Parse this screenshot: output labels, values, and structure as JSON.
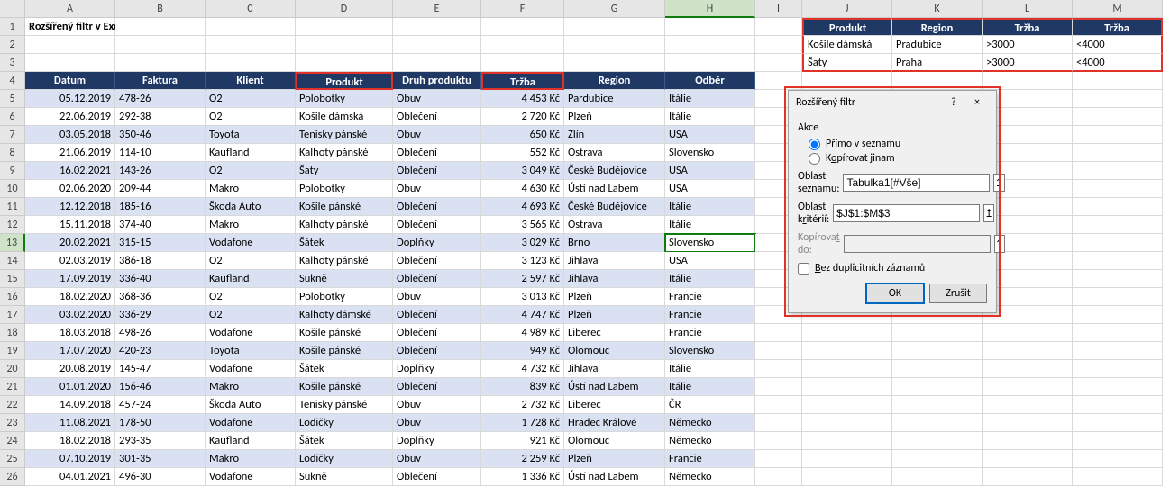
{
  "columns": [
    "A",
    "B",
    "C",
    "D",
    "E",
    "F",
    "G",
    "H",
    "I",
    "J",
    "K",
    "L",
    "M"
  ],
  "row_count": 26,
  "title_cell": "Rozšířený filtr v Excelu",
  "table": {
    "headers": [
      "Datum",
      "Faktura",
      "Klient",
      "Produkt",
      "Druh produktu",
      "Tržba",
      "Region",
      "Odběr"
    ],
    "rows": [
      [
        "05.12.2019",
        "478-26",
        "O2",
        "Polobotky",
        "Obuv",
        "4 453 Kč",
        "Pardubice",
        "Itálie"
      ],
      [
        "22.06.2019",
        "292-38",
        "O2",
        "Košile dámská",
        "Oblečení",
        "2 720 Kč",
        "Plzeň",
        "Itálie"
      ],
      [
        "03.05.2018",
        "350-46",
        "Toyota",
        "Tenisky pánské",
        "Obuv",
        "650 Kč",
        "Zlín",
        "USA"
      ],
      [
        "21.06.2019",
        "114-10",
        "Kaufland",
        "Kalhoty pánské",
        "Oblečení",
        "552 Kč",
        "Ostrava",
        "Slovensko"
      ],
      [
        "16.02.2021",
        "143-26",
        "O2",
        "Šaty",
        "Oblečení",
        "3 049 Kč",
        "České Budějovice",
        "USA"
      ],
      [
        "02.06.2020",
        "209-44",
        "Makro",
        "Polobotky",
        "Obuv",
        "4 630 Kč",
        "Ústí nad Labem",
        "USA"
      ],
      [
        "12.12.2018",
        "185-16",
        "Škoda Auto",
        "Košile pánské",
        "Oblečení",
        "4 693 Kč",
        "České Budějovice",
        "Itálie"
      ],
      [
        "15.11.2018",
        "374-40",
        "Makro",
        "Kalhoty pánské",
        "Oblečení",
        "3 565 Kč",
        "Ostrava",
        "Itálie"
      ],
      [
        "20.02.2021",
        "315-15",
        "Vodafone",
        "Šátek",
        "Doplňky",
        "3 029 Kč",
        "Brno",
        "Slovensko"
      ],
      [
        "02.03.2019",
        "386-18",
        "O2",
        "Kalhoty pánské",
        "Oblečení",
        "3 123 Kč",
        "Jihlava",
        "USA"
      ],
      [
        "17.09.2019",
        "336-40",
        "Kaufland",
        "Sukně",
        "Oblečení",
        "2 597 Kč",
        "Jihlava",
        "Itálie"
      ],
      [
        "18.02.2020",
        "368-36",
        "O2",
        "Polobotky",
        "Obuv",
        "3 013 Kč",
        "Plzeň",
        "Francie"
      ],
      [
        "03.02.2020",
        "336-29",
        "O2",
        "Kalhoty dámské",
        "Oblečení",
        "4 747 Kč",
        "Plzeň",
        "Francie"
      ],
      [
        "18.03.2018",
        "498-26",
        "Vodafone",
        "Košile pánské",
        "Oblečení",
        "4 989 Kč",
        "Liberec",
        "Francie"
      ],
      [
        "17.07.2020",
        "420-23",
        "Toyota",
        "Košile pánské",
        "Oblečení",
        "949 Kč",
        "Olomouc",
        "Slovensko"
      ],
      [
        "20.08.2019",
        "145-47",
        "Vodafone",
        "Šátek",
        "Doplňky",
        "4 732 Kč",
        "Jihlava",
        "Itálie"
      ],
      [
        "01.01.2020",
        "156-46",
        "Makro",
        "Košile pánské",
        "Oblečení",
        "839 Kč",
        "Ústí nad Labem",
        "Itálie"
      ],
      [
        "14.09.2018",
        "457-24",
        "Škoda Auto",
        "Tenisky pánské",
        "Obuv",
        "2 732 Kč",
        "Liberec",
        "ČR"
      ],
      [
        "11.08.2021",
        "178-50",
        "Vodafone",
        "Lodičky",
        "Obuv",
        "1 728 Kč",
        "Hradec Králové",
        "Německo"
      ],
      [
        "18.02.2018",
        "293-35",
        "Kaufland",
        "Šátek",
        "Doplňky",
        "921 Kč",
        "Olomouc",
        "Německo"
      ],
      [
        "07.10.2019",
        "301-35",
        "Makro",
        "Lodičky",
        "Obuv",
        "2 259 Kč",
        "Plzeň",
        "Francie"
      ],
      [
        "04.01.2021",
        "496-30",
        "Vodafone",
        "Sukně",
        "Oblečení",
        "1 336 Kč",
        "Ústí nad Labem",
        "Německo"
      ]
    ]
  },
  "criteria": {
    "headers": [
      "Produkt",
      "Region",
      "Tržba",
      "Tržba"
    ],
    "rows": [
      [
        "Košile dámská",
        "Pradubice",
        ">3000",
        "<4000"
      ],
      [
        "Šaty",
        "Praha",
        ">3000",
        "<4000"
      ]
    ]
  },
  "active_cell": {
    "row": 13,
    "col": "H"
  },
  "dialog": {
    "title": "Rozšířený filtr",
    "help": "?",
    "close": "×",
    "group_label": "Akce",
    "radio_direct": "Přímo v seznamu",
    "radio_copy": "Kopírovat jinam",
    "radio_selected": "direct",
    "field_list_label": "Oblast seznamu:",
    "field_list_value": "Tabulka1[#Vše]",
    "field_crit_label": "Oblast kritérií:",
    "field_crit_value": "$J$1:$M$3",
    "field_copy_label": "Kopírovat do:",
    "field_copy_value": "",
    "check_label": "Bez duplicitních záznamů",
    "check_checked": false,
    "ok": "OK",
    "cancel": "Zrušit"
  },
  "chart_data": {
    "type": "table",
    "title": "Rozšířený filtr v Excelu",
    "columns": [
      "Datum",
      "Faktura",
      "Klient",
      "Produkt",
      "Druh produktu",
      "Tržba",
      "Region",
      "Odběr"
    ],
    "rows": [
      [
        "05.12.2019",
        "478-26",
        "O2",
        "Polobotky",
        "Obuv",
        4453,
        "Pardubice",
        "Itálie"
      ],
      [
        "22.06.2019",
        "292-38",
        "O2",
        "Košile dámská",
        "Oblečení",
        2720,
        "Plzeň",
        "Itálie"
      ],
      [
        "03.05.2018",
        "350-46",
        "Toyota",
        "Tenisky pánské",
        "Obuv",
        650,
        "Zlín",
        "USA"
      ],
      [
        "21.06.2019",
        "114-10",
        "Kaufland",
        "Kalhoty pánské",
        "Oblečení",
        552,
        "Ostrava",
        "Slovensko"
      ],
      [
        "16.02.2021",
        "143-26",
        "O2",
        "Šaty",
        "Oblečení",
        3049,
        "České Budějovice",
        "USA"
      ],
      [
        "02.06.2020",
        "209-44",
        "Makro",
        "Polobotky",
        "Obuv",
        4630,
        "Ústí nad Labem",
        "USA"
      ],
      [
        "12.12.2018",
        "185-16",
        "Škoda Auto",
        "Košile pánské",
        "Oblečení",
        4693,
        "České Budějovice",
        "Itálie"
      ],
      [
        "15.11.2018",
        "374-40",
        "Makro",
        "Kalhoty pánské",
        "Oblečení",
        3565,
        "Ostrava",
        "Itálie"
      ],
      [
        "20.02.2021",
        "315-15",
        "Vodafone",
        "Šátek",
        "Doplňky",
        3029,
        "Brno",
        "Slovensko"
      ],
      [
        "02.03.2019",
        "386-18",
        "O2",
        "Kalhoty pánské",
        "Oblečení",
        3123,
        "Jihlava",
        "USA"
      ],
      [
        "17.09.2019",
        "336-40",
        "Kaufland",
        "Sukně",
        "Oblečení",
        2597,
        "Jihlava",
        "Itálie"
      ],
      [
        "18.02.2020",
        "368-36",
        "O2",
        "Polobotky",
        "Obuv",
        3013,
        "Plzeň",
        "Francie"
      ],
      [
        "03.02.2020",
        "336-29",
        "O2",
        "Kalhoty dámské",
        "Oblečení",
        4747,
        "Plzeň",
        "Francie"
      ],
      [
        "18.03.2018",
        "498-26",
        "Vodafone",
        "Košile pánské",
        "Oblečení",
        4989,
        "Liberec",
        "Francie"
      ],
      [
        "17.07.2020",
        "420-23",
        "Toyota",
        "Košile pánské",
        "Oblečení",
        949,
        "Olomouc",
        "Slovensko"
      ],
      [
        "20.08.2019",
        "145-47",
        "Vodafone",
        "Šátek",
        "Doplňky",
        4732,
        "Jihlava",
        "Itálie"
      ],
      [
        "01.01.2020",
        "156-46",
        "Makro",
        "Košile pánské",
        "Oblečení",
        839,
        "Ústí nad Labem",
        "Itálie"
      ],
      [
        "14.09.2018",
        "457-24",
        "Škoda Auto",
        "Tenisky pánské",
        "Obuv",
        2732,
        "Liberec",
        "ČR"
      ],
      [
        "11.08.2021",
        "178-50",
        "Vodafone",
        "Lodičky",
        "Obuv",
        1728,
        "Hradec Králové",
        "Německo"
      ],
      [
        "18.02.2018",
        "293-35",
        "Kaufland",
        "Šátek",
        "Doplňky",
        921,
        "Olomouc",
        "Německo"
      ],
      [
        "07.10.2019",
        "301-35",
        "Makro",
        "Lodičky",
        "Obuv",
        2259,
        "Plzeň",
        "Francie"
      ],
      [
        "04.01.2021",
        "496-30",
        "Vodafone",
        "Sukně",
        "Oblečení",
        1336,
        "Ústí nad Labem",
        "Německo"
      ]
    ]
  }
}
